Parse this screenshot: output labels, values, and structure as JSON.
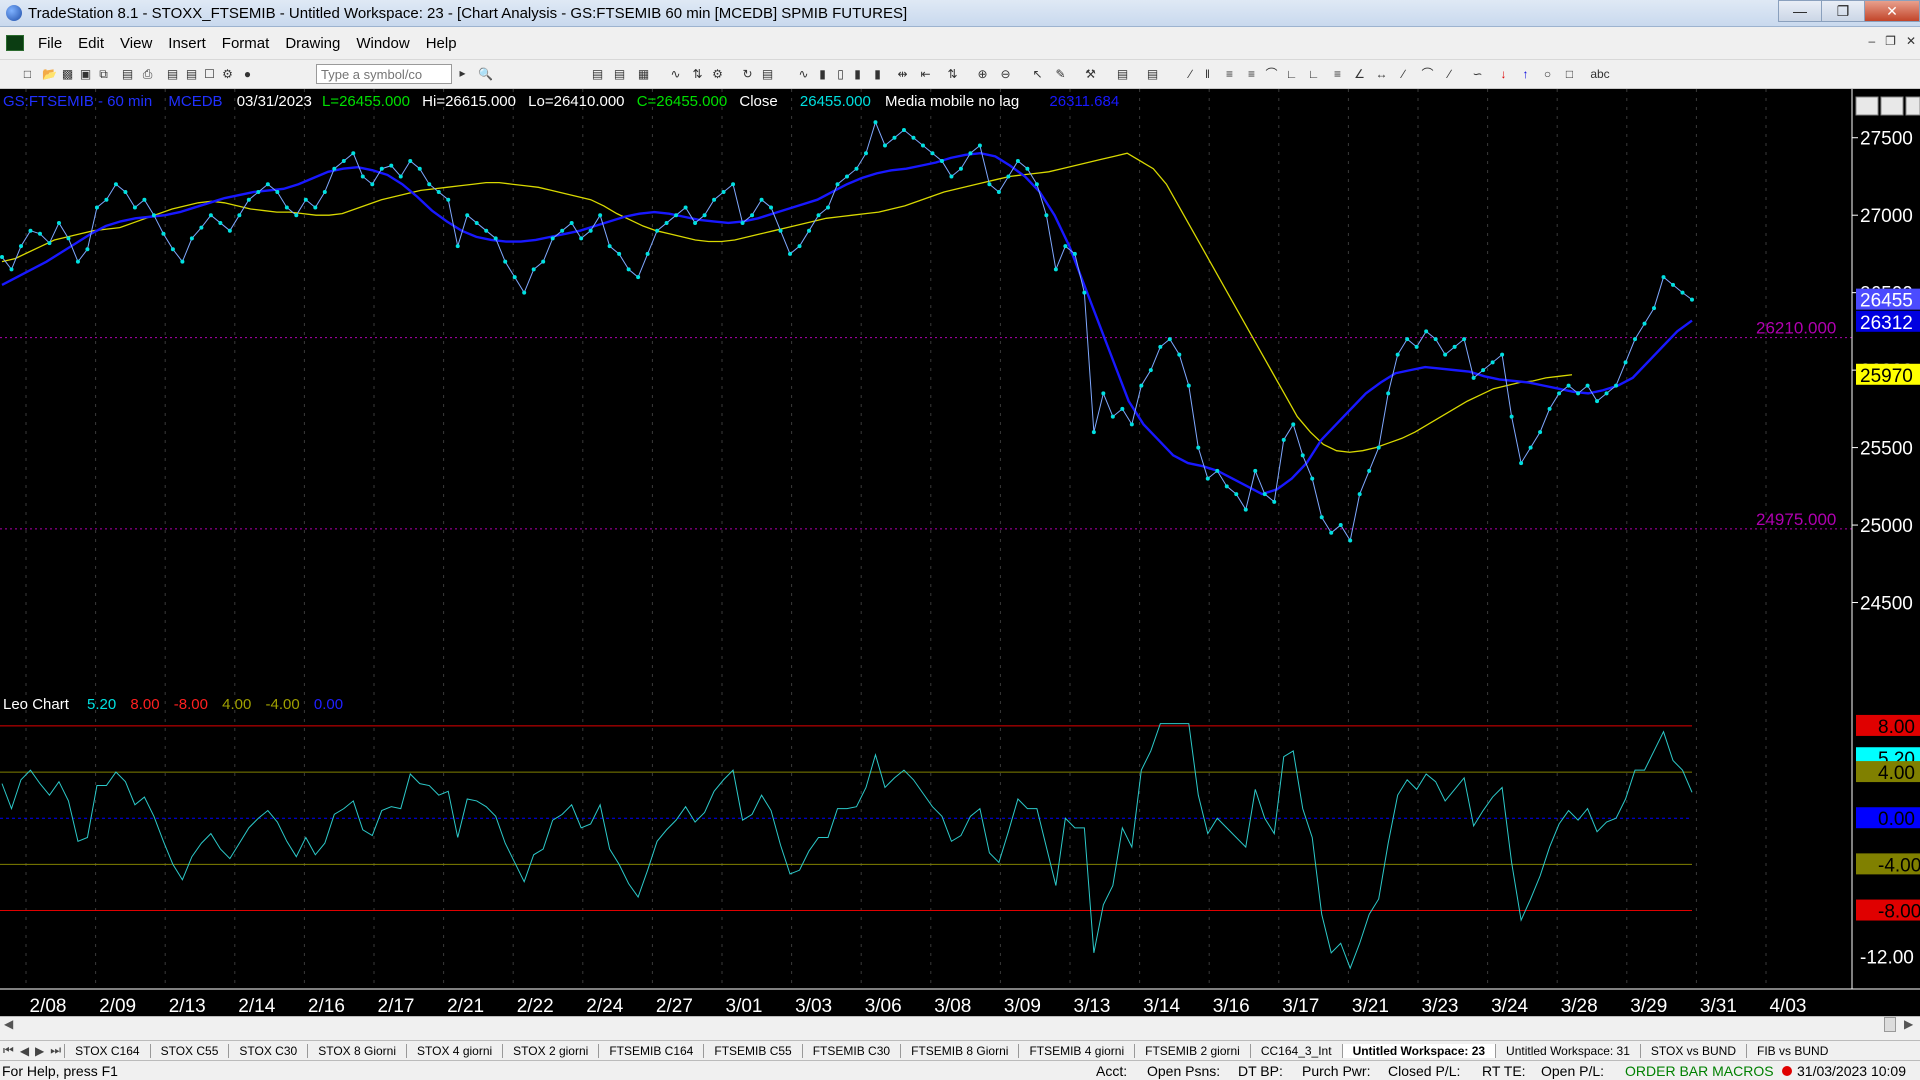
{
  "window": {
    "title": "TradeStation 8.1 - STOXX_FTSEMIB - Untitled Workspace:  23 - [Chart Analysis - GS:FTSEMIB  60 min  [MCEDB] SPMIB FUTURES]"
  },
  "menu": [
    "File",
    "Edit",
    "View",
    "Insert",
    "Format",
    "Drawing",
    "Window",
    "Help"
  ],
  "toolbar": {
    "symbol_placeholder": "Type a symbol/co",
    "text_tool": "abc"
  },
  "header": {
    "symbol": "GS:FTSEMIB - 60 min",
    "source": "MCEDB",
    "date": "03/31/2023",
    "low_label": "L=26455.000",
    "hi": "Hi=26615.000",
    "lo": "Lo=26410.000",
    "close_label": "C=26455.000",
    "close_word": "Close",
    "close_val": "26455.000",
    "ma_name": "Media mobile no lag",
    "ma_val": "26311.684"
  },
  "price_axis": {
    "ticks": [
      "27500",
      "27000",
      "26500",
      "26000",
      "25500",
      "25000",
      "24500"
    ]
  },
  "price_markers": [
    {
      "text": "26455",
      "bg": "#4b4bff",
      "fg": "#ffffff"
    },
    {
      "text": "26312",
      "bg": "#0000e0",
      "fg": "#ffffff"
    },
    {
      "text": "25970",
      "bg": "#ffff00",
      "fg": "#000000"
    }
  ],
  "hlines_labels": [
    "26210.000",
    "24975.000"
  ],
  "indicator": {
    "name": "Leo Chart",
    "values": [
      "5.20",
      "8.00",
      "-8.00",
      "4.00",
      "-4.00",
      "0.00"
    ],
    "value_colors": [
      "#00e0e0",
      "#ff2020",
      "#ff2020",
      "#a0a000",
      "#a0a000",
      "#2020ff"
    ],
    "axis_markers": [
      {
        "text": "8.00",
        "bg": "#e00000",
        "fg": "#000000"
      },
      {
        "text": "5.20",
        "bg": "#00ffff",
        "fg": "#000000"
      },
      {
        "text": "4.00",
        "bg": "#808000",
        "fg": "#000000"
      },
      {
        "text": "0.00",
        "bg": "#0000ff",
        "fg": "#000000"
      },
      {
        "text": "-4.00",
        "bg": "#808000",
        "fg": "#000000"
      },
      {
        "text": "-8.00",
        "bg": "#e00000",
        "fg": "#000000"
      }
    ],
    "axis_ticks": [
      "-12.00"
    ]
  },
  "date_axis": [
    "2/08",
    "2/09",
    "2/13",
    "2/14",
    "2/16",
    "2/17",
    "2/21",
    "2/22",
    "2/24",
    "2/27",
    "3/01",
    "3/03",
    "3/06",
    "3/08",
    "3/09",
    "3/13",
    "3/14",
    "3/16",
    "3/17",
    "3/21",
    "3/23",
    "3/24",
    "3/28",
    "3/29",
    "3/31",
    "4/03"
  ],
  "chart_data": {
    "type": "line",
    "price_series": {
      "name": "",
      "y_range": [
        24200,
        27750
      ],
      "close": [
        26730,
        26650,
        26800,
        26900,
        26880,
        26820,
        26950,
        26850,
        26700,
        26780,
        27050,
        27100,
        27200,
        27150,
        27050,
        27100,
        27000,
        26880,
        26780,
        26700,
        26850,
        26920,
        27000,
        26950,
        26900,
        27000,
        27100,
        27150,
        27200,
        27150,
        27050,
        27000,
        27100,
        27050,
        27150,
        27300,
        27350,
        27400,
        27250,
        27200,
        27300,
        27320,
        27250,
        27350,
        27300,
        27200,
        27150,
        27100,
        26800,
        27000,
        26950,
        26900,
        26850,
        26700,
        26600,
        26500,
        26650,
        26700,
        26850,
        26900,
        26950,
        26850,
        26900,
        27000,
        26800,
        26750,
        26650,
        26600,
        26750,
        26900,
        26950,
        27000,
        27050,
        26950,
        27000,
        27100,
        27150,
        27200,
        26950,
        27000,
        27100,
        27050,
        26900,
        26750,
        26800,
        26900,
        27000,
        27050,
        27200,
        27250,
        27300,
        27400,
        27600,
        27450,
        27500,
        27550,
        27500,
        27450,
        27400,
        27350,
        27250,
        27300,
        27400,
        27450,
        27200,
        27150,
        27250,
        27350,
        27300,
        27200,
        27000,
        26650,
        26800,
        26750,
        26500,
        25600,
        25850,
        25700,
        25750,
        25650,
        25900,
        26000,
        26150,
        26200,
        26100,
        25900,
        25500,
        25300,
        25350,
        25250,
        25200,
        25100,
        25350,
        25200,
        25150,
        25550,
        25650,
        25450,
        25300,
        25050,
        24950,
        25000,
        24900,
        25200,
        25350,
        25500,
        25850,
        26100,
        26200,
        26150,
        26250,
        26200,
        26100,
        26150,
        26200,
        25950,
        26000,
        26050,
        26100,
        25700,
        25400,
        25500,
        25600,
        25750,
        25850,
        25900,
        25850,
        25900,
        25800,
        25850,
        25900,
        26050,
        26200,
        26300,
        26400,
        26600,
        26550,
        26500,
        26455
      ],
      "ma_yellow": [
        26700,
        26720,
        26760,
        26800,
        26840,
        26860,
        26880,
        26900,
        26910,
        26920,
        26950,
        26980,
        27010,
        27040,
        27060,
        27080,
        27090,
        27080,
        27060,
        27040,
        27030,
        27020,
        27020,
        27010,
        27000,
        27000,
        27010,
        27040,
        27070,
        27100,
        27120,
        27140,
        27160,
        27170,
        27180,
        27190,
        27200,
        27210,
        27210,
        27200,
        27190,
        27180,
        27160,
        27140,
        27120,
        27100,
        27060,
        27010,
        26970,
        26930,
        26900,
        26880,
        26860,
        26840,
        26830,
        26830,
        26840,
        26860,
        26880,
        26900,
        26920,
        26940,
        26960,
        26980,
        26990,
        27000,
        27010,
        27020,
        27040,
        27060,
        27090,
        27120,
        27150,
        27170,
        27190,
        27210,
        27230,
        27250,
        27260,
        27270,
        27280,
        27300,
        27320,
        27340,
        27360,
        27380,
        27400,
        27350,
        27300,
        27200,
        27050,
        26900,
        26750,
        26600,
        26450,
        26300,
        26150,
        26000,
        25850,
        25700,
        25600,
        25520,
        25480,
        25470,
        25480,
        25500,
        25530,
        25560,
        25600,
        25650,
        25700,
        25750,
        25800,
        25840,
        25880,
        25900,
        25920,
        25930,
        25950,
        25960,
        25970
      ],
      "ma_blue": [
        26550,
        26600,
        26650,
        26700,
        26760,
        26820,
        26880,
        26930,
        26960,
        26980,
        26990,
        27000,
        27020,
        27050,
        27080,
        27110,
        27130,
        27150,
        27160,
        27170,
        27200,
        27240,
        27280,
        27300,
        27310,
        27290,
        27260,
        27200,
        27120,
        27030,
        26960,
        26900,
        26860,
        26840,
        26830,
        26830,
        26840,
        26860,
        26880,
        26900,
        26930,
        26960,
        26990,
        27010,
        27020,
        27010,
        26990,
        26970,
        26960,
        26950,
        26960,
        26980,
        27010,
        27040,
        27070,
        27100,
        27150,
        27200,
        27240,
        27270,
        27290,
        27300,
        27320,
        27340,
        27370,
        27390,
        27400,
        27380,
        27320,
        27250,
        27150,
        27000,
        26800,
        26550,
        26300,
        26050,
        25800,
        25650,
        25550,
        25450,
        25400,
        25380,
        25350,
        25300,
        25250,
        25200,
        25230,
        25300,
        25400,
        25550,
        25650,
        25750,
        25850,
        25920,
        25980,
        26000,
        26020,
        26010,
        26000,
        25990,
        25960,
        25940,
        25930,
        25920,
        25900,
        25880,
        25860,
        25850,
        25870,
        25900,
        25950,
        26050,
        26150,
        26250,
        26320
      ]
    },
    "hlines": [
      26210,
      24975
    ],
    "indicator_series": {
      "name": "Leo Chart",
      "y_range": [
        -13.5,
        8.6
      ],
      "levels": [
        8,
        4,
        0,
        -4,
        -8
      ]
    }
  }
}
